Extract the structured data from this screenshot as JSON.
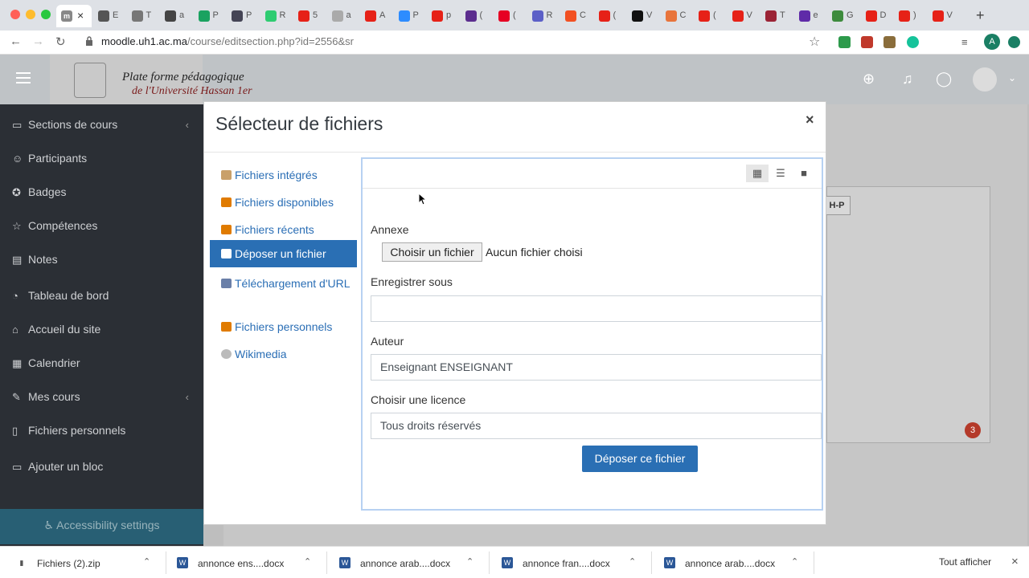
{
  "browser": {
    "url_host": "moodle.uh1.ac.ma",
    "url_path": "/course/editsection.php?id=2556&sr",
    "active_tab_label": "m",
    "tab_labels": [
      "E",
      "T",
      "a",
      "P",
      "P",
      "R",
      "5",
      "a",
      "A",
      "P",
      "p",
      "(",
      "(",
      "R",
      "C",
      "(",
      "V",
      "C",
      "(",
      "V",
      "T",
      "e",
      "G",
      "D",
      ")",
      "V"
    ],
    "profile_initial": "A"
  },
  "site": {
    "logo_line1": "Plate forme pédagogique",
    "logo_line2": "de l'Université Hassan 1er",
    "notification_count": "3",
    "h5p_label": "H-P"
  },
  "drawer": {
    "items": [
      {
        "label": "Sections de cours",
        "icon": "folder-icon",
        "caret": true
      },
      {
        "label": "Participants",
        "icon": "users-icon"
      },
      {
        "label": "Badges",
        "icon": "badge-icon"
      },
      {
        "label": "Compétences",
        "icon": "star-icon"
      },
      {
        "label": "Notes",
        "icon": "grades-icon"
      },
      {
        "label": "Tableau de bord",
        "icon": "dashboard-icon"
      },
      {
        "label": "Accueil du site",
        "icon": "home-icon"
      },
      {
        "label": "Calendrier",
        "icon": "calendar-icon"
      },
      {
        "label": "Mes cours",
        "icon": "graduation-cap-icon",
        "caret": true
      },
      {
        "label": "Fichiers personnels",
        "icon": "file-icon"
      },
      {
        "label": "Ajouter un bloc",
        "icon": "add-block-icon"
      }
    ],
    "accessibility_label": "Accessibility settings"
  },
  "modal": {
    "title": "Sélecteur de fichiers",
    "close_label": "×",
    "repositories": [
      {
        "label": "Fichiers intégrés",
        "icon": "embedded-files-icon"
      },
      {
        "label": "Fichiers disponibles",
        "icon": "server-files-icon"
      },
      {
        "label": "Fichiers récents",
        "icon": "recent-files-icon"
      },
      {
        "label": "Déposer un fichier",
        "icon": "upload-icon",
        "active": true
      },
      {
        "label": "Téléchargement d'URL",
        "icon": "url-download-icon"
      },
      {
        "label": "Fichiers personnels",
        "icon": "private-files-icon"
      },
      {
        "label": "Wikimedia",
        "icon": "wikimedia-icon"
      }
    ],
    "form": {
      "attachment_label": "Annexe",
      "choose_file_button": "Choisir un fichier",
      "no_file_text": "Aucun fichier choisi",
      "save_as_label": "Enregistrer sous",
      "save_as_value": "",
      "author_label": "Auteur",
      "author_value": "Enseignant ENSEIGNANT",
      "license_label": "Choisir une licence",
      "license_value": "Tous droits réservés",
      "submit_button": "Déposer ce fichier"
    }
  },
  "downloads": {
    "items": [
      {
        "name": "Fichiers (2).zip",
        "type": "zip"
      },
      {
        "name": "annonce ens....docx",
        "type": "docx"
      },
      {
        "name": "annonce arab....docx",
        "type": "docx"
      },
      {
        "name": "annonce fran....docx",
        "type": "docx"
      },
      {
        "name": "annonce arab....docx",
        "type": "docx"
      }
    ],
    "show_all": "Tout afficher",
    "close": "×"
  },
  "colors": {
    "primary": "#2a6fb4",
    "link": "#2a6eb5",
    "drawer_bg": "#2b2f35",
    "accessibility_bg": "#27708a"
  }
}
